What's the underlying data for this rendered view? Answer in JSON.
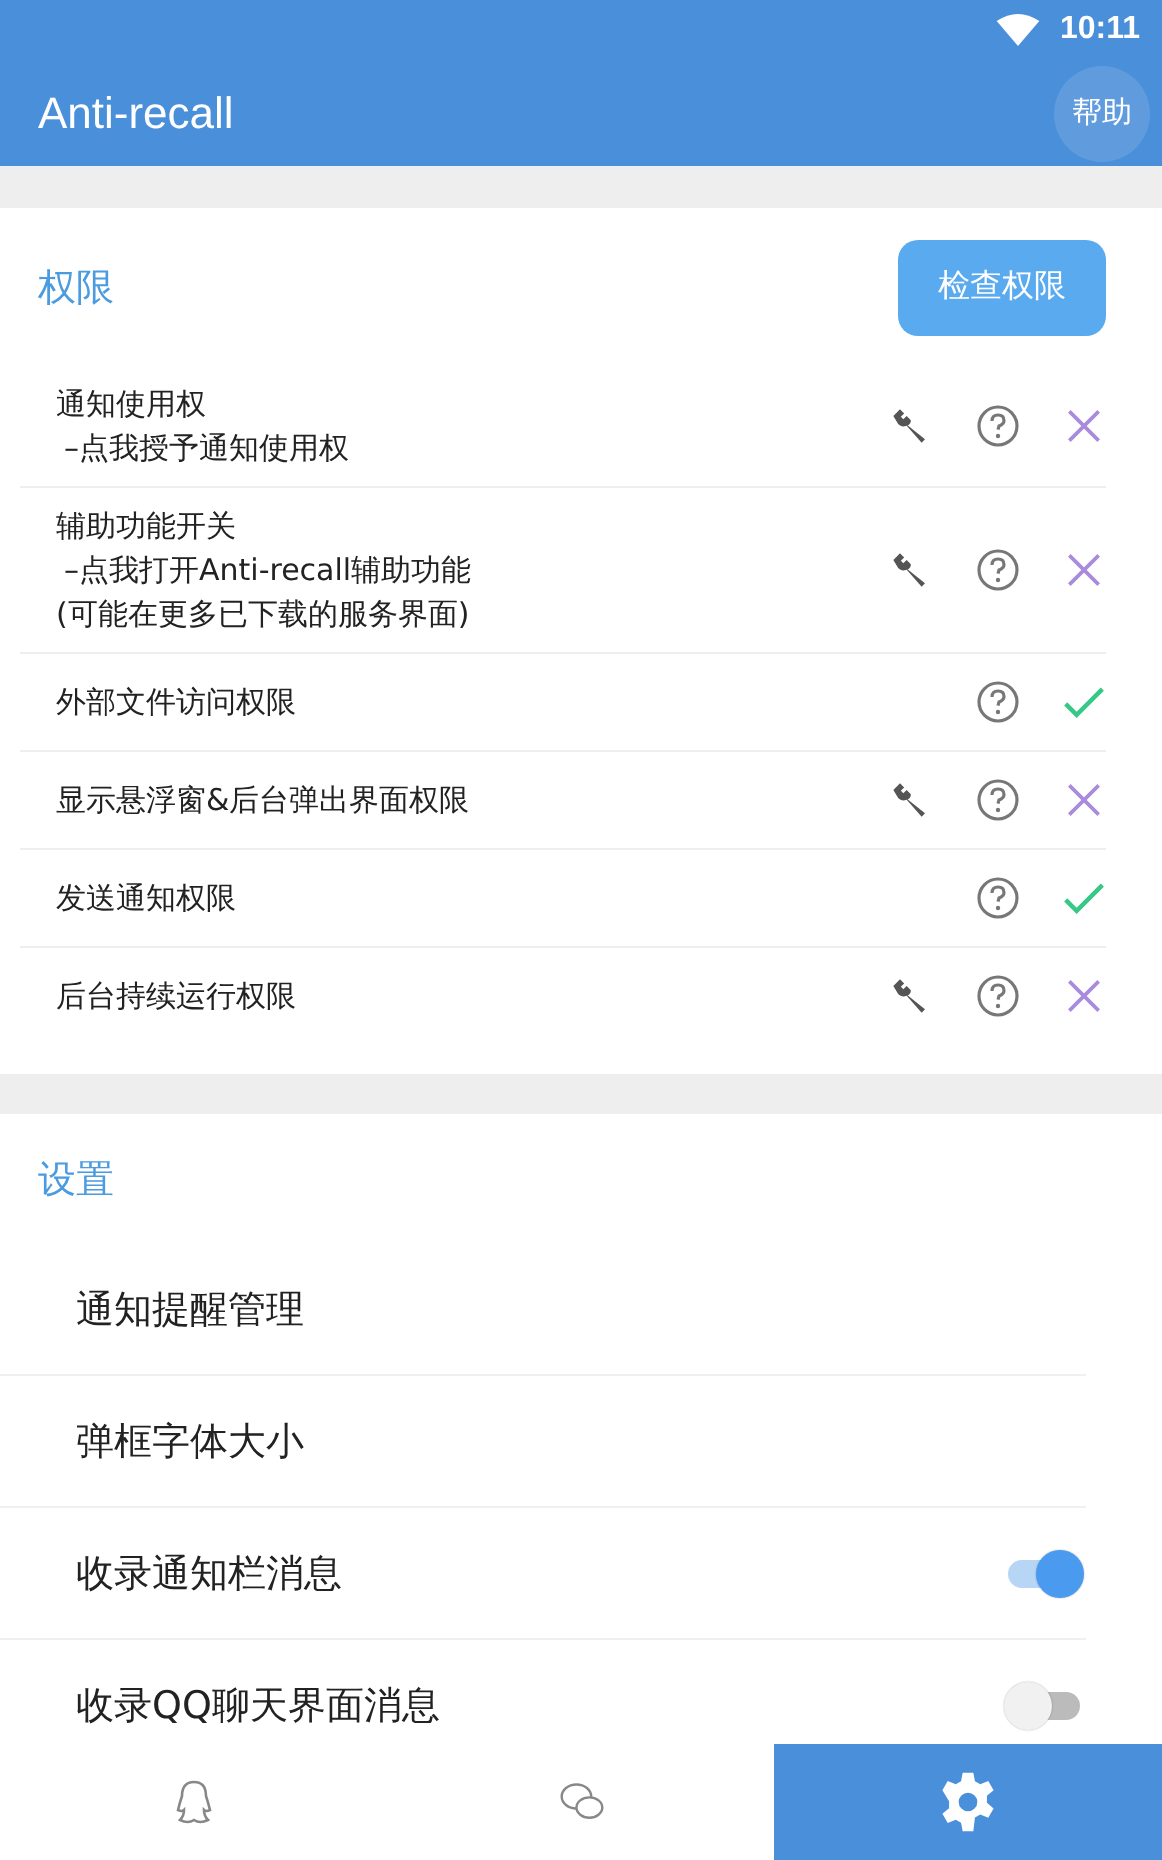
{
  "status_bar": {
    "time": "10:11"
  },
  "app_bar": {
    "title": "Anti-recall",
    "help_button": "帮助"
  },
  "permissions": {
    "header": "权限",
    "check_button": "检查权限",
    "items": [
      {
        "title": "通知使用权",
        "hint": "–点我授予通知使用权",
        "fixable": true,
        "granted": false
      },
      {
        "title": "辅助功能开关",
        "hint": "–点我打开Anti-recall辅助功能",
        "note": "(可能在更多已下载的服务界面)",
        "fixable": true,
        "granted": false
      },
      {
        "title": "外部文件访问权限",
        "fixable": false,
        "granted": true
      },
      {
        "title": "显示悬浮窗&后台弹出界面权限",
        "fixable": true,
        "granted": false
      },
      {
        "title": "发送通知权限",
        "fixable": false,
        "granted": true
      },
      {
        "title": "后台持续运行权限",
        "fixable": true,
        "granted": false
      }
    ]
  },
  "settings": {
    "header": "设置",
    "items": [
      {
        "kind": "link",
        "label": "通知提醒管理"
      },
      {
        "kind": "link",
        "label": "弹框字体大小"
      },
      {
        "kind": "toggle",
        "label": "收录通知栏消息",
        "on": true
      },
      {
        "kind": "toggle",
        "label": "收录QQ聊天界面消息",
        "on": false
      }
    ]
  },
  "bottom_nav": [
    {
      "kind": "qq",
      "selected": false
    },
    {
      "kind": "wechat",
      "selected": false
    },
    {
      "kind": "settings",
      "selected": true
    }
  ]
}
